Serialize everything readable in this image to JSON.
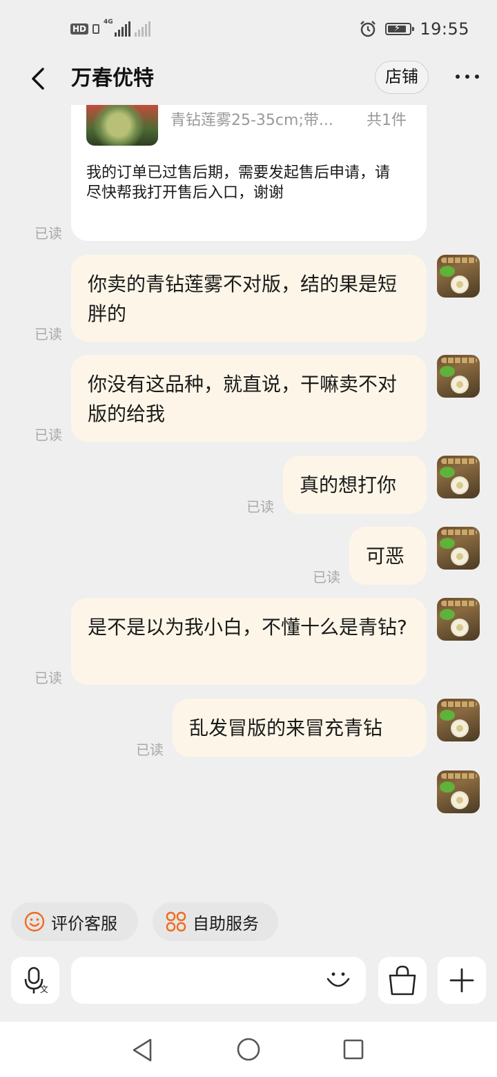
{
  "status_bar": {
    "hd_label": "HD",
    "network_label": "4G",
    "time": "19:55"
  },
  "header": {
    "title": "万春优特",
    "shop_button": "店铺"
  },
  "order_card": {
    "spec": "青钻莲雾25-35cm;带...",
    "count": "共1件",
    "message": "我的订单已过售后期，需要发起售后申请，请尽快帮我打开售后入口，谢谢",
    "read": "已读"
  },
  "messages": [
    {
      "text": "你卖的青钻莲雾不对版，结的果是短胖的",
      "read": "已读"
    },
    {
      "text": "你没有这品种，就直说，干嘛卖不对版的给我",
      "read": "已读"
    },
    {
      "text": "真的想打你",
      "read": "已读"
    },
    {
      "text": "可恶",
      "read": "已读"
    },
    {
      "text": "是不是以为我小白，不懂十么是青钻?",
      "read": "已读"
    },
    {
      "text": "乱发冒版的来冒充青钻",
      "read": "已读"
    }
  ],
  "quick_actions": [
    {
      "label": "评价客服",
      "icon": "smile-icon"
    },
    {
      "label": "自助服务",
      "icon": "grid-icon"
    }
  ],
  "input_bar": {
    "placeholder": "",
    "voice_icon": "microphone-translate-icon",
    "emoji_icon": "emoji-icon",
    "bag_icon": "shopping-bag-icon",
    "add_icon": "plus-icon"
  },
  "colors": {
    "background": "#efefef",
    "bubble": "#fdf6e8",
    "accent": "#f06a1e",
    "read_text": "#a8a8a8"
  }
}
